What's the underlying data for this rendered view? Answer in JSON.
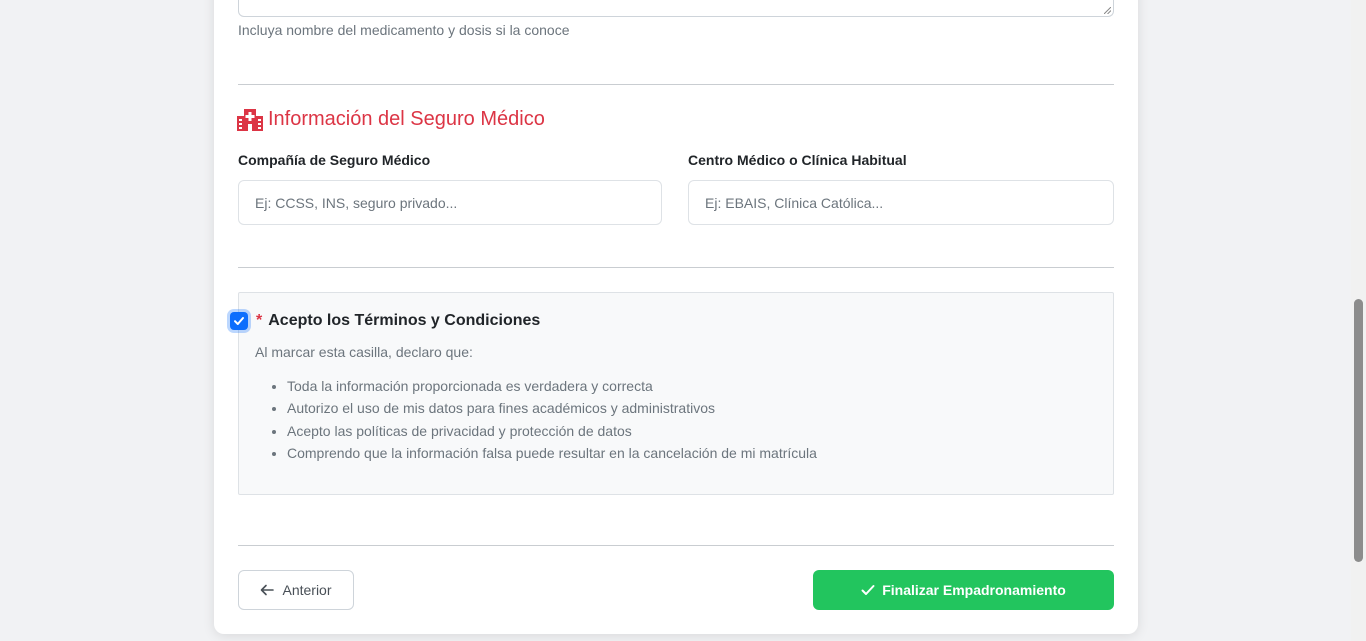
{
  "medication": {
    "help_text": "Incluya nombre del medicamento y dosis si la conoce"
  },
  "insurance": {
    "title": "Información del Seguro Médico",
    "title_icon": "hospital-icon",
    "company_label": "Compañía de Seguro Médico",
    "company_placeholder": "Ej: CCSS, INS, seguro privado...",
    "company_value": "",
    "clinic_label": "Centro Médico o Clínica Habitual",
    "clinic_placeholder": "Ej: EBAIS, Clínica Católica...",
    "clinic_value": ""
  },
  "terms": {
    "checked": true,
    "required_mark": "*",
    "title": "Acepto los Términos y Condiciones",
    "intro": "Al marcar esta casilla, declaro que:",
    "items": [
      "Toda la información proporcionada es verdadera y correcta",
      "Autorizo el uso de mis datos para fines académicos y administrativos",
      "Acepto las políticas de privacidad y protección de datos",
      "Comprendo que la información falsa puede resultar en la cancelación de mi matrícula"
    ]
  },
  "navigation": {
    "prev_label": "Anterior",
    "finish_label": "Finalizar Empadronamiento"
  },
  "colors": {
    "accent_red": "#dc3545",
    "primary_blue": "#0d6efd",
    "success_green": "#22c55e"
  }
}
